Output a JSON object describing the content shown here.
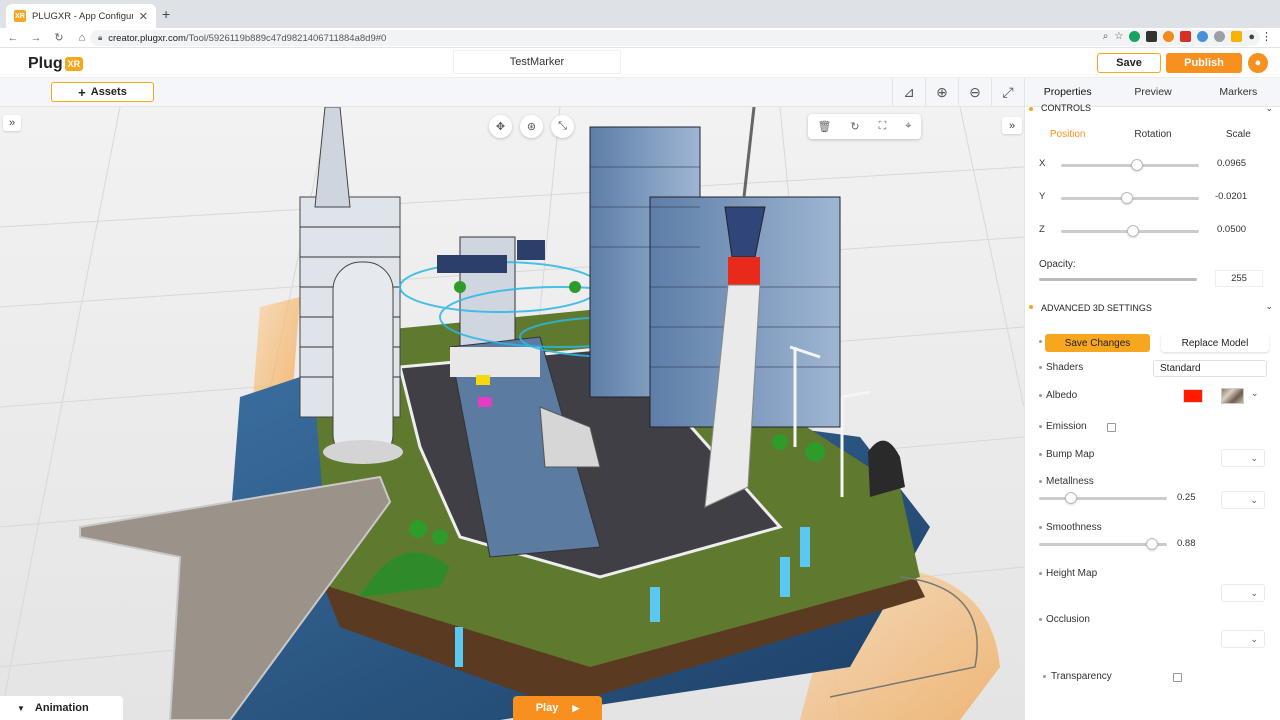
{
  "browser": {
    "tab_title": "PLUGXR - App Configurator",
    "favicon_text": "XR",
    "url_prefix": "creator.plugxr.com",
    "url_path": "/Tool/5926119b889c47d9821406711884a8d9#0"
  },
  "header": {
    "logo_text": "Plug",
    "logo_badge": "XR",
    "project_name": "TestMarker",
    "save_label": "Save",
    "publish_label": "Publish",
    "accent_color": "#f7901e"
  },
  "toolbar": {
    "assets_label": "Assets"
  },
  "viewport": {
    "animation_label": "Animation",
    "play_label": "Play"
  },
  "panel": {
    "tabs": [
      {
        "label": "Properties"
      },
      {
        "label": "Preview"
      },
      {
        "label": "Markers"
      }
    ],
    "controls_title": "CONTROLS",
    "sub_tabs": [
      {
        "label": "Position"
      },
      {
        "label": "Rotation"
      },
      {
        "label": "Scale"
      }
    ],
    "position": [
      {
        "axis": "X",
        "value": "0.0965",
        "level": 0.55
      },
      {
        "axis": "Y",
        "value": "-0.0201",
        "level": 0.48
      },
      {
        "axis": "Z",
        "value": "0.0500",
        "level": 0.52
      }
    ],
    "opacity_label": "Opacity:",
    "opacity_value": "255",
    "advanced_title": "ADVANCED 3D SETTINGS",
    "save_changes_label": "Save Changes",
    "replace_model_label": "Replace Model",
    "shaders_label": "Shaders",
    "shaders_value": "Standard",
    "albedo_label": "Albedo",
    "albedo_color": "#ff1a00",
    "emission_label": "Emission",
    "bump_map_label": "Bump Map",
    "metallness_label": "Metallness",
    "metallness_value": "0.25",
    "smoothness_label": "Smoothness",
    "smoothness_value": "0.88",
    "height_map_label": "Height Map",
    "occlusion_label": "Occlusion",
    "transparency_label": "Transparency"
  }
}
